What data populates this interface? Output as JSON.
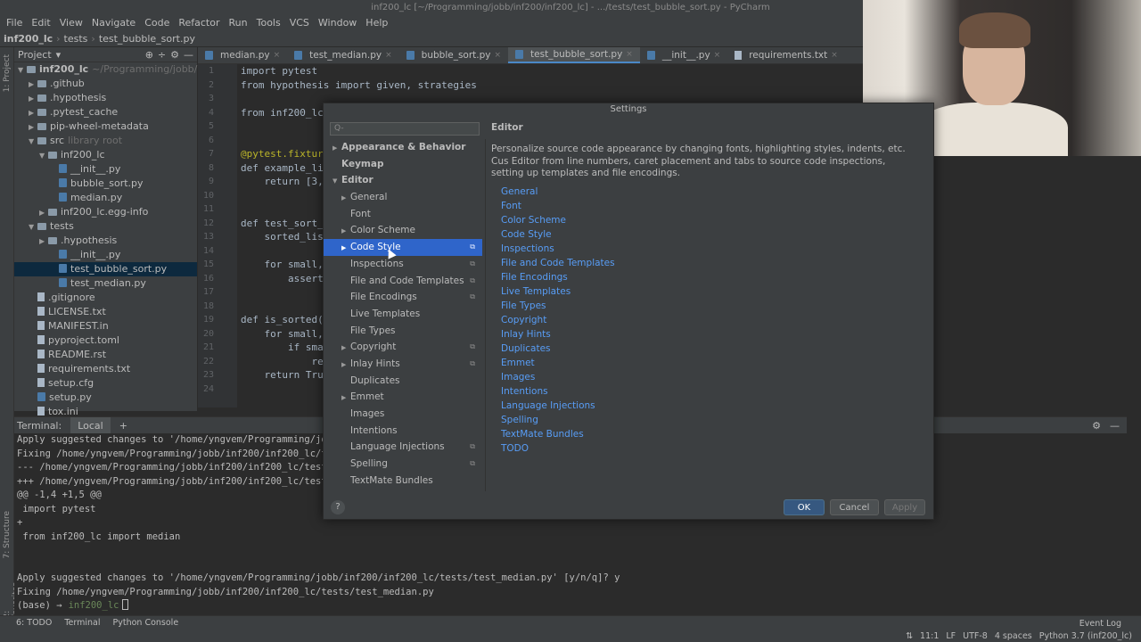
{
  "window": {
    "title": "inf200_lc [~/Programming/jobb/inf200/inf200_lc] - .../tests/test_bubble_sort.py - PyCharm"
  },
  "menu": [
    "File",
    "Edit",
    "View",
    "Navigate",
    "Code",
    "Refactor",
    "Run",
    "Tools",
    "VCS",
    "Window",
    "Help"
  ],
  "breadcrumb": [
    "inf200_lc",
    "tests",
    "test_bubble_sort.py"
  ],
  "project": {
    "label": "Project",
    "side_tabs": [
      "1: Project",
      "7: Structure",
      "2: Favorites"
    ],
    "root_label": "inf200_lc",
    "root_path": "~/Programming/jobb/inf200/in",
    "items": [
      ".github",
      ".hypothesis",
      ".pytest_cache",
      "pip-wheel-metadata",
      "src",
      "inf200_lc",
      "__init__.py",
      "bubble_sort.py",
      "median.py",
      "inf200_lc.egg-info",
      "tests",
      ".hypothesis",
      "__init__.py",
      "test_bubble_sort.py",
      "test_median.py",
      ".gitignore",
      "LICENSE.txt",
      "MANIFEST.in",
      "pyproject.toml",
      "README.rst",
      "requirements.txt",
      "setup.cfg",
      "setup.py",
      "tox.ini"
    ],
    "src_note": "library root"
  },
  "tabs": [
    "median.py",
    "test_median.py",
    "bubble_sort.py",
    "test_bubble_sort.py",
    "__init__.py",
    "requirements.txt"
  ],
  "code": {
    "line_numbers": [
      "1",
      "2",
      "3",
      "4",
      "5",
      "6",
      "7",
      "8",
      "9",
      "10",
      "11",
      "12",
      "13",
      "14",
      "15",
      "16",
      "17",
      "18",
      "19",
      "20",
      "21",
      "22",
      "23",
      "24"
    ],
    "lines": [
      "import pytest",
      "from hypothesis import given, strategies",
      "",
      "from inf200_lc",
      "",
      "",
      "@pytest.fixtur",
      "def example_li",
      "    return [3,",
      "",
      "",
      "def test_sort_",
      "    sorted_lis",
      "",
      "    for small,",
      "        assert",
      "",
      "",
      "def is_sorted(",
      "    for small,",
      "        if sma",
      "            re",
      "    return Tru",
      ""
    ]
  },
  "terminal": {
    "label": "Terminal:",
    "tab": "Local",
    "lines": [
      "Apply suggested changes to '/home/yngvem/Programming/jobb",
      "Fixing /home/yngvem/Programming/jobb/inf200/inf200_lc/tes",
      "--- /home/yngvem/Programming/jobb/inf200/inf200_lc/tests/",
      "+++ /home/yngvem/Programming/jobb/inf200/inf200_lc/tests/",
      "@@ -1,4 +1,5 @@",
      " import pytest",
      "+",
      " from inf200_lc import median",
      "",
      "",
      "Apply suggested changes to '/home/yngvem/Programming/jobb/inf200/inf200_lc/tests/test_median.py' [y/n/q]? y",
      "Fixing /home/yngvem/Programming/jobb/inf200/inf200_lc/tests/test_median.py"
    ],
    "prompt": "(base) →",
    "prompt_dir": "inf200_lc"
  },
  "settings": {
    "title": "Settings",
    "search_placeholder": "Q-",
    "tree": [
      {
        "label": "Appearance & Behavior",
        "level": 0,
        "arrow": "▶",
        "bold": true
      },
      {
        "label": "Keymap",
        "level": 0,
        "arrow": "",
        "bold": true
      },
      {
        "label": "Editor",
        "level": 0,
        "arrow": "▼",
        "bold": true
      },
      {
        "label": "General",
        "level": 1,
        "arrow": "▶"
      },
      {
        "label": "Font",
        "level": 1,
        "arrow": ""
      },
      {
        "label": "Color Scheme",
        "level": 1,
        "arrow": "▶"
      },
      {
        "label": "Code Style",
        "level": 1,
        "arrow": "▶",
        "selected": true,
        "copy": true
      },
      {
        "label": "Inspections",
        "level": 1,
        "arrow": "",
        "copy": true
      },
      {
        "label": "File and Code Templates",
        "level": 1,
        "arrow": "",
        "copy": true
      },
      {
        "label": "File Encodings",
        "level": 1,
        "arrow": "",
        "copy": true
      },
      {
        "label": "Live Templates",
        "level": 1,
        "arrow": ""
      },
      {
        "label": "File Types",
        "level": 1,
        "arrow": ""
      },
      {
        "label": "Copyright",
        "level": 1,
        "arrow": "▶",
        "copy": true
      },
      {
        "label": "Inlay Hints",
        "level": 1,
        "arrow": "▶",
        "copy": true
      },
      {
        "label": "Duplicates",
        "level": 1,
        "arrow": ""
      },
      {
        "label": "Emmet",
        "level": 1,
        "arrow": "▶"
      },
      {
        "label": "Images",
        "level": 1,
        "arrow": ""
      },
      {
        "label": "Intentions",
        "level": 1,
        "arrow": ""
      },
      {
        "label": "Language Injections",
        "level": 1,
        "arrow": "",
        "copy": true
      },
      {
        "label": "Spelling",
        "level": 1,
        "arrow": "",
        "copy": true
      },
      {
        "label": "TextMate Bundles",
        "level": 1,
        "arrow": ""
      }
    ],
    "heading": "Editor",
    "description": "Personalize source code appearance by changing fonts, highlighting styles, indents, etc. Cus Editor from line numbers, caret placement and tabs to source code inspections, setting up templates and file encodings.",
    "links": [
      "General",
      "Font",
      "Color Scheme",
      "Code Style",
      "Inspections",
      "File and Code Templates",
      "File Encodings",
      "Live Templates",
      "File Types",
      "Copyright",
      "Inlay Hints",
      "Duplicates",
      "Emmet",
      "Images",
      "Intentions",
      "Language Injections",
      "Spelling",
      "TextMate Bundles",
      "TODO"
    ],
    "ok": "OK",
    "cancel": "Cancel",
    "apply": "Apply",
    "help": "?"
  },
  "status": {
    "bottom_tabs": [
      "6: TODO",
      "Terminal",
      "Python Console"
    ],
    "event_log": "Event Log",
    "right": [
      "11:1",
      "LF",
      "UTF-8",
      "4 spaces",
      "Python 3.7 (inf200_lc)"
    ]
  },
  "colors": {
    "accent": "#2f65ca",
    "link": "#589df6",
    "ok_button": "#365880"
  }
}
